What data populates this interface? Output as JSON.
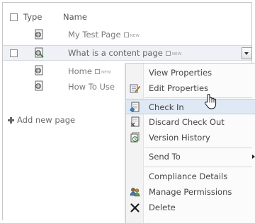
{
  "list": {
    "columns": {
      "type": "Type",
      "name": "Name"
    },
    "rows": [
      {
        "name": "My Test Page",
        "new_tag": "NEW",
        "icon": "page-icon"
      },
      {
        "name": "What is a content page",
        "new_tag": "NEW",
        "icon": "page-icon"
      },
      {
        "name": "Home",
        "new_tag": "NEW",
        "icon": "page-icon"
      },
      {
        "name": "How To Use",
        "new_tag": "",
        "icon": "page-icon"
      }
    ],
    "add_new_page": "Add new page"
  },
  "context_menu": {
    "items": [
      {
        "label": "View Properties",
        "icon": ""
      },
      {
        "label": "Edit Properties",
        "icon": "edit-properties-icon"
      },
      {
        "label": "Check In",
        "icon": "check-in-icon"
      },
      {
        "label": "Discard Check Out",
        "icon": "discard-check-out-icon"
      },
      {
        "label": "Version History",
        "icon": "version-history-icon"
      },
      {
        "label": "Send To",
        "icon": ""
      },
      {
        "label": "Compliance Details",
        "icon": ""
      },
      {
        "label": "Manage Permissions",
        "icon": "manage-permissions-icon"
      },
      {
        "label": "Delete",
        "icon": "delete-icon"
      }
    ]
  }
}
